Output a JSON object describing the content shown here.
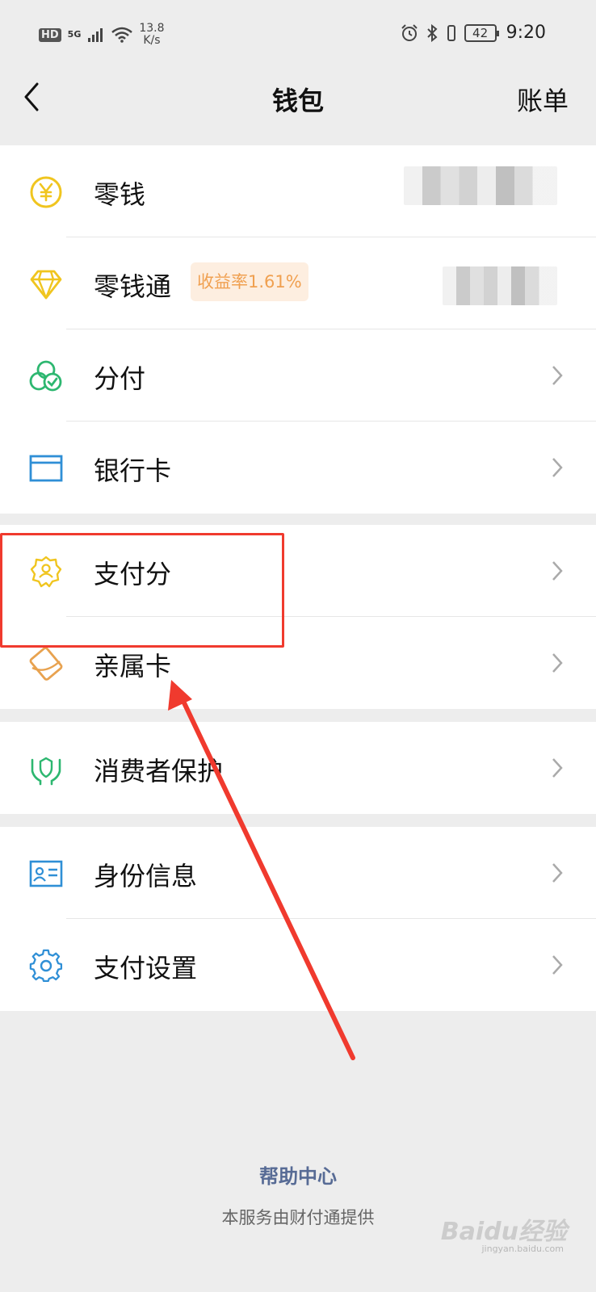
{
  "status_bar": {
    "hd": "HD",
    "network": "5G",
    "speed_value": "13.8",
    "speed_unit": "K/s",
    "battery": "42",
    "time": "9:20"
  },
  "nav": {
    "title": "钱包",
    "action": "账单"
  },
  "groups": [
    {
      "items": [
        {
          "label": "零钱",
          "icon": "yuan-coin-icon"
        },
        {
          "label": "零钱通",
          "icon": "diamond-icon",
          "badge": "收益率1.61%"
        },
        {
          "label": "分付",
          "icon": "three-circles-check-icon"
        },
        {
          "label": "银行卡",
          "icon": "bank-card-icon"
        }
      ]
    },
    {
      "items": [
        {
          "label": "支付分",
          "icon": "badge-person-icon"
        },
        {
          "label": "亲属卡",
          "icon": "family-card-icon"
        }
      ]
    },
    {
      "items": [
        {
          "label": "消费者保护",
          "icon": "hands-shield-icon"
        }
      ]
    },
    {
      "items": [
        {
          "label": "身份信息",
          "icon": "id-card-icon"
        },
        {
          "label": "支付设置",
          "icon": "gear-icon"
        }
      ]
    }
  ],
  "footer": {
    "help": "帮助中心",
    "provider": "本服务由财付通提供"
  },
  "watermark": {
    "brand": "Baidu经验",
    "url": "jingyan.baidu.com"
  },
  "colors": {
    "background": "#ededed",
    "link": "#576b95",
    "badge_text": "#f0a050",
    "badge_bg": "#fdeee0",
    "annotation_red": "#f03a2e"
  }
}
